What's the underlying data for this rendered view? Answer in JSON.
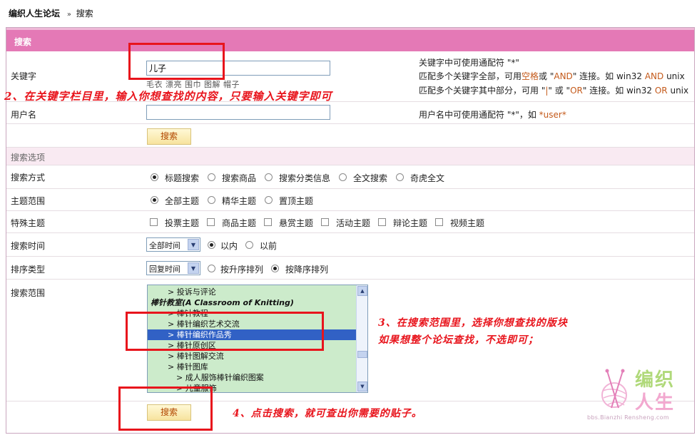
{
  "breadcrumb": {
    "home": "编织人生论坛",
    "separator": "»",
    "current": "搜索"
  },
  "search_panel": {
    "header": "搜索",
    "keyword": {
      "label": "关键字",
      "value": "儿子",
      "hot_terms": "毛衣 漂亮 围巾 图解 帽子"
    },
    "tips": {
      "line1": "关键字中可使用通配符 \"*\"",
      "line2_pre": "匹配多个关键字全部，可用",
      "line2_space": "空格",
      "line2_mid": "或 \"",
      "line2_and_q": "AND",
      "line2_post": "\" 连接。如  win32 ",
      "line2_and": "AND",
      "line2_end": " unix",
      "line3_pre": "匹配多个关键字其中部分，可用 \"",
      "line3_bar": "|",
      "line3_mid": "\" 或 \"",
      "line3_or_q": "OR",
      "line3_post": "\" 连接。如  win32 ",
      "line3_or": "OR",
      "line3_end": " unix"
    },
    "username": {
      "label": "用户名",
      "value": "",
      "tip_pre": "用户名中可使用通配符 \"*\"，如 ",
      "tip_example": "*user*"
    },
    "search_button": "搜索"
  },
  "options": {
    "header": "搜索选项",
    "mode": {
      "label": "搜索方式",
      "choices": [
        "标题搜索",
        "搜索商品",
        "搜索分类信息",
        "全文搜索",
        "奇虎全文"
      ],
      "selected": "标题搜索"
    },
    "scope": {
      "label": "主题范围",
      "choices": [
        "全部主题",
        "精华主题",
        "置顶主题"
      ],
      "selected": "全部主题"
    },
    "special": {
      "label": "特殊主题",
      "choices": [
        "投票主题",
        "商品主题",
        "悬赏主题",
        "活动主题",
        "辩论主题",
        "视频主题"
      ]
    },
    "time": {
      "label": "搜索时间",
      "select_value": "全部时间",
      "choices": [
        "以内",
        "以前"
      ],
      "selected": "以内"
    },
    "order": {
      "label": "排序类型",
      "select_value": "回复时间",
      "choices": [
        "按升序排列",
        "按降序排列"
      ],
      "selected": "按降序排列"
    },
    "forum_range": {
      "label": "搜索范围",
      "items": [
        {
          "text": "> 投诉与评论",
          "kind": "sub",
          "selected": false
        },
        {
          "text": "棒针教室(A Classroom of Knitting)",
          "kind": "cat",
          "selected": false
        },
        {
          "text": "> 棒针教程",
          "kind": "sub",
          "selected": false
        },
        {
          "text": "> 棒针编织艺术交流",
          "kind": "sub",
          "selected": false
        },
        {
          "text": "> 棒针编织作品秀",
          "kind": "sub",
          "selected": true
        },
        {
          "text": "> 棒针原创区",
          "kind": "sub",
          "selected": false
        },
        {
          "text": "> 棒针图解交流",
          "kind": "sub",
          "selected": false
        },
        {
          "text": "> 棒针图库",
          "kind": "sub",
          "selected": false
        },
        {
          "text": "> 成人服饰棒针编织图案",
          "kind": "sub2",
          "selected": false
        },
        {
          "text": "> 儿童服饰",
          "kind": "sub2",
          "selected": false
        }
      ]
    },
    "bottom_button": "搜索"
  },
  "annotations": {
    "step2": "2、在关键字栏目里，输入你想查找的内容，只要输入关键字即可",
    "step3_line1": "3、在搜索范围里，选择你想查找的版块",
    "step3_line2": "如果想整个论坛查找，不选即可；",
    "step4": "4、点击搜索，就可查出你需要的贴子。"
  },
  "watermark": {
    "line1": "编织",
    "line2": "人生",
    "url": "bbs.Bianzhi Rensheng.com"
  },
  "colors": {
    "header_pink": "#e479b6",
    "section_pink": "#f9eaf2",
    "annotation_red": "#e8141c",
    "selection_blue": "#3161c5",
    "listbox_green": "#ccebcb"
  }
}
